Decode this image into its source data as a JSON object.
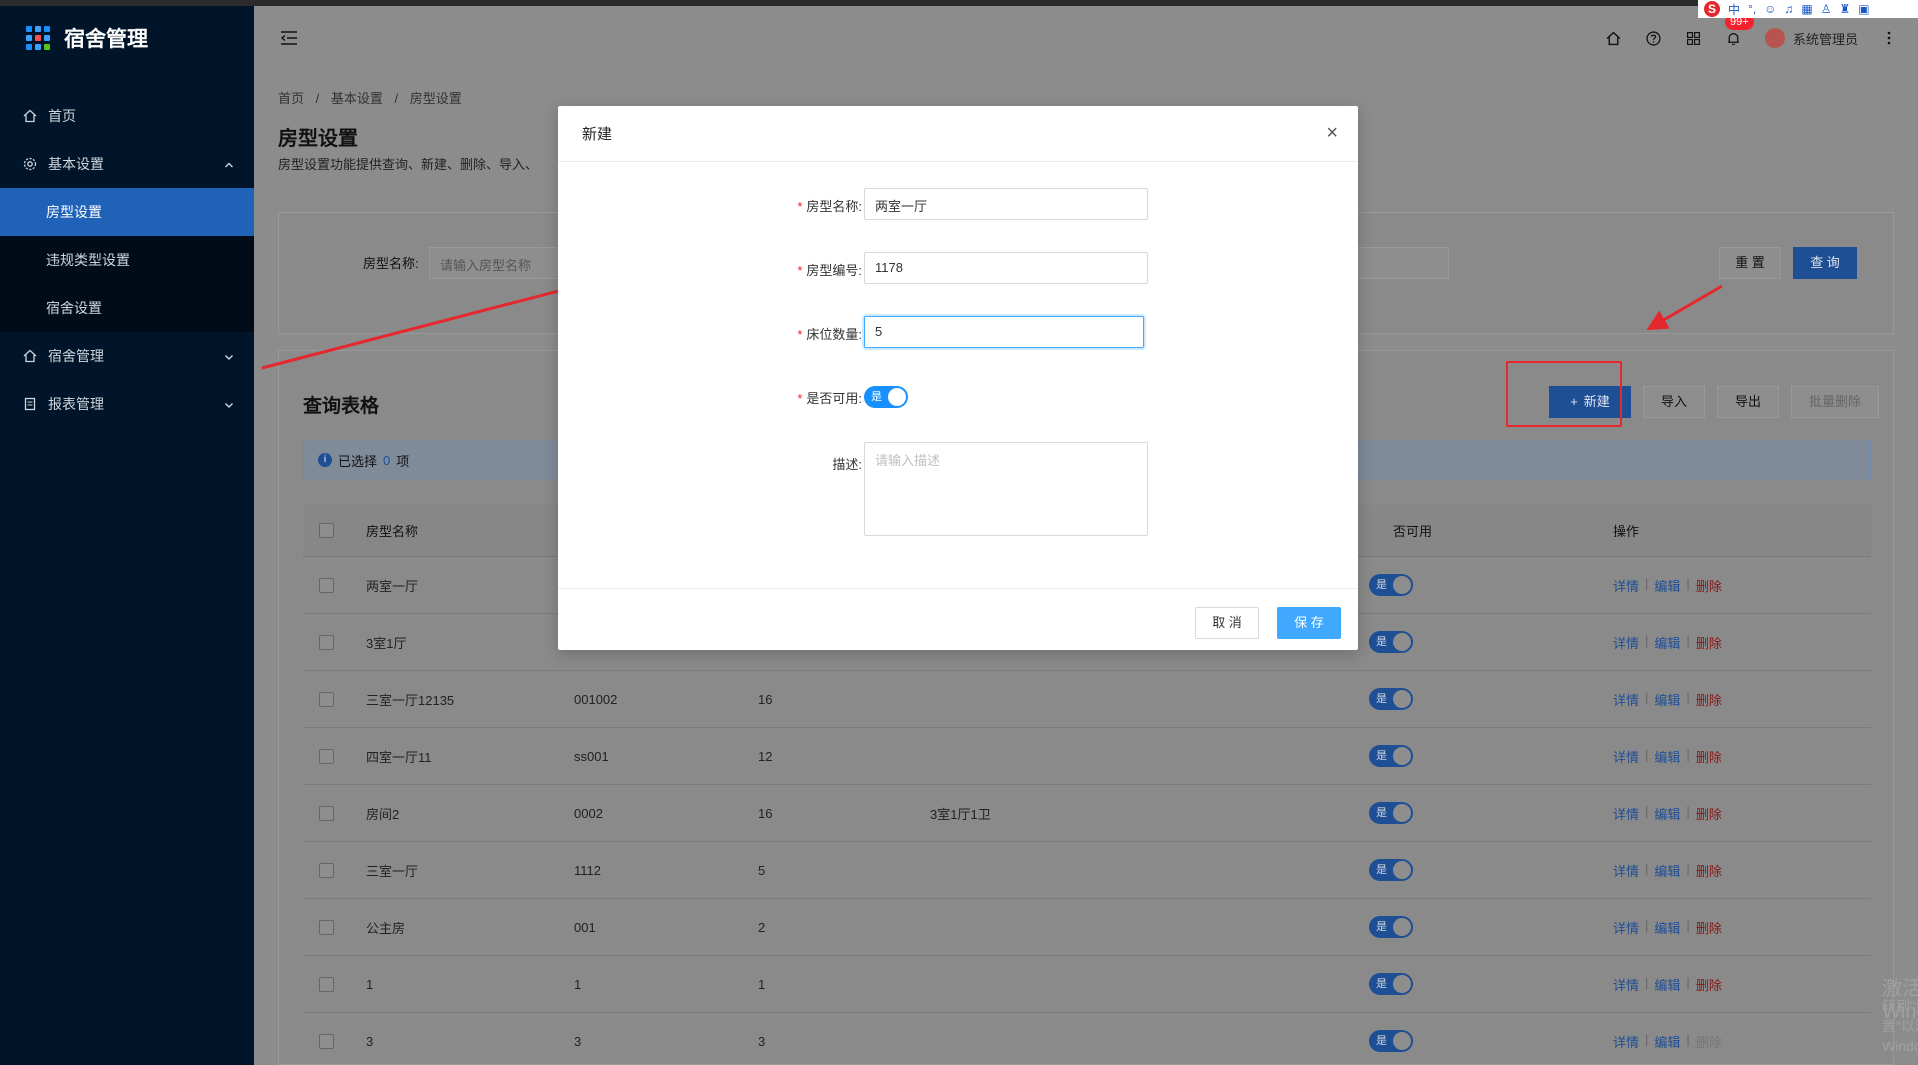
{
  "app": {
    "title": "宿舍管理"
  },
  "sidebar": {
    "items": [
      {
        "label": "首页",
        "icon": "home-icon"
      },
      {
        "label": "基本设置",
        "icon": "gear-icon"
      },
      {
        "label": "房型设置"
      },
      {
        "label": "违规类型设置"
      },
      {
        "label": "宿舍设置"
      },
      {
        "label": "宿舍管理",
        "icon": "home-icon"
      },
      {
        "label": "报表管理",
        "icon": "document-icon"
      }
    ]
  },
  "header": {
    "badge": "99+",
    "username": "系统管理员"
  },
  "ime": {
    "label": "中"
  },
  "breadcrumb": {
    "home": "首页",
    "level1": "基本设置",
    "level2": "房型设置",
    "sep": "/"
  },
  "page": {
    "title": "房型设置",
    "desc": "房型设置功能提供查询、新建、删除、导入、"
  },
  "search": {
    "label": "房型名称:",
    "placeholder": "请输入房型名称",
    "reset": "重 置",
    "query": "查 询"
  },
  "table": {
    "title": "查询表格",
    "buttons": {
      "new": "新建",
      "import": "导入",
      "export": "导出",
      "batch_delete": "批量删除"
    },
    "selected_prefix": "已选择",
    "selected_count": "0",
    "selected_suffix": "项",
    "headers": {
      "name": "房型名称",
      "enabled": "否可用",
      "ops": "操作"
    },
    "ops": {
      "detail": "详情",
      "edit": "编辑",
      "delete": "删除",
      "sep": "|"
    },
    "switch_on": "是",
    "rows": [
      {
        "name": "两室一厅",
        "code": "",
        "beds": "",
        "desc": ""
      },
      {
        "name": "3室1厅",
        "code": "",
        "beds": "",
        "desc": ""
      },
      {
        "name": "三室一厅12135",
        "code": "001002",
        "beds": "16",
        "desc": ""
      },
      {
        "name": "四室一厅11",
        "code": "ss001",
        "beds": "12",
        "desc": ""
      },
      {
        "name": "房间2",
        "code": "0002",
        "beds": "16",
        "desc": "3室1厅1卫"
      },
      {
        "name": "三室一厅",
        "code": "1112",
        "beds": "5",
        "desc": ""
      },
      {
        "name": "公主房",
        "code": "001",
        "beds": "2",
        "desc": ""
      },
      {
        "name": "1",
        "code": "1",
        "beds": "1",
        "desc": ""
      },
      {
        "name": "3",
        "code": "3",
        "beds": "3",
        "desc": ""
      }
    ]
  },
  "watermark": {
    "line1": "激活 Windows",
    "line2": "转到\"设置\"以激活 Windows。"
  },
  "modal": {
    "title": "新建",
    "close": "×",
    "fields": {
      "name": {
        "label": "房型名称:",
        "value": "两室一厅"
      },
      "code": {
        "label": "房型编号:",
        "value": "1178"
      },
      "beds": {
        "label": "床位数量:",
        "value": "5"
      },
      "enabled": {
        "label": "是否可用:",
        "value": "是"
      },
      "desc": {
        "label": "描述:",
        "placeholder": "请输入描述"
      }
    },
    "required_mark": "*",
    "cancel": "取 消",
    "save": "保 存"
  },
  "colors": {
    "primary": "#1890ff",
    "sidebar_bg": "#001529",
    "danger": "#f5222d",
    "annotation": "#e5282e"
  }
}
